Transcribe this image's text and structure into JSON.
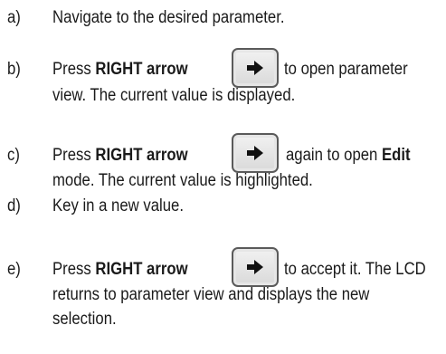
{
  "steps": [
    {
      "letter": "a)",
      "line1": "Navigate to the desired parameter."
    },
    {
      "letter": "b)",
      "press": "Press",
      "key_label": "RIGHT arrow",
      "after_key": "to open parameter",
      "line2": "view. The current value is displayed.",
      "key_icon": "right-arrow-icon"
    },
    {
      "letter": "c)",
      "press": "Press",
      "key_label": "RIGHT arrow",
      "after_key": "again to open",
      "after_key_bold": "Edit",
      "line2": "mode. The current value is highlighted.",
      "key_icon": "right-arrow-icon"
    },
    {
      "letter": "d)",
      "line1": "Key in a new value."
    },
    {
      "letter": "e)",
      "press": "Press",
      "key_label": "RIGHT arrow",
      "after_key": "to accept it. The LCD",
      "line2": "returns to parameter view and displays the new",
      "line3": "selection.",
      "key_icon": "right-arrow-icon"
    }
  ]
}
